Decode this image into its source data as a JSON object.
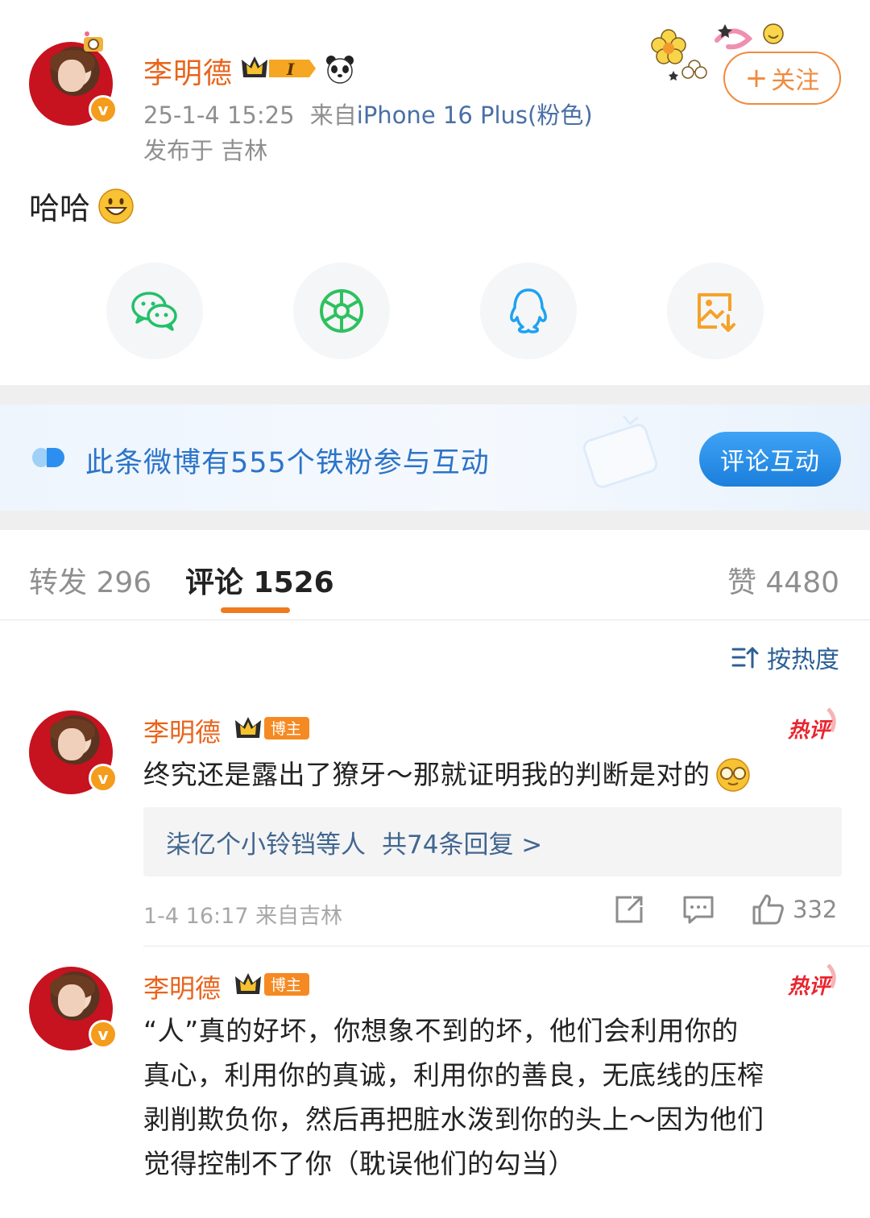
{
  "post": {
    "author": "李明德",
    "time": "25-1-4 15:25",
    "from_label": "来自",
    "device": "iPhone 16 Plus(粉色)",
    "location": "发布于 吉林",
    "follow_label": "关注",
    "text": "哈哈",
    "share_targets": [
      "wechat-icon",
      "moments-icon",
      "qq-icon",
      "save-image-icon"
    ]
  },
  "banner": {
    "text": "此条微博有555个铁粉参与互动",
    "button": "评论互动"
  },
  "tabs": {
    "repost": "转发 296",
    "comments": "评论 1526",
    "likes": "赞 4480"
  },
  "sort_label": "按热度",
  "comments": [
    {
      "author": "李明德",
      "badge": "博主",
      "hot_label": "热评",
      "text": "终究还是露出了獠牙～那就证明我的判断是对的",
      "reply_users": "柒亿个小铃铛等人",
      "reply_count": "共74条回复 >",
      "meta": "1-4 16:17  来自吉林",
      "likes": "332"
    },
    {
      "author": "李明德",
      "badge": "博主",
      "hot_label": "热评",
      "lines": [
        "“人”真的好坏，你想象不到的坏，他们会利用你的",
        "真心，利用你的真诚，利用你的善良，无底线的压榨",
        "剥削欺负你，然后再把脏水泼到你的头上～因为他们",
        "觉得控制不了你（耽误他们的勾当）"
      ]
    }
  ],
  "colors": {
    "name_orange": "#e8641b",
    "link_blue": "#2c74c8",
    "meta_gray": "#8f8f8f",
    "tab_underline": "#f07a1e",
    "banner_button": "#1b7fdc"
  }
}
